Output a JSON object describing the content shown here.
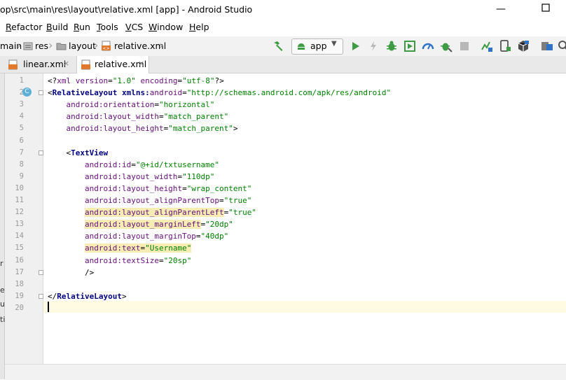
{
  "window": {
    "title": "op\\src\\main\\res\\layout\\relative.xml [app] - Android Studio",
    "minimize": "—",
    "maximize": "☐"
  },
  "menu": {
    "items": [
      {
        "label": "Refactor",
        "u": "R",
        "rest": "efactor"
      },
      {
        "label": "Build",
        "u": "B",
        "rest": "uild"
      },
      {
        "label": "Run",
        "u": "R",
        "rest": "un"
      },
      {
        "label": "Tools",
        "u": "T",
        "rest": "ools"
      },
      {
        "label": "VCS",
        "u": "V",
        "rest": "CS"
      },
      {
        "label": "Window",
        "u": "W",
        "rest": "indow"
      },
      {
        "label": "Help",
        "u": "H",
        "rest": "elp"
      }
    ]
  },
  "breadcrumbs": {
    "items": [
      "main",
      "res",
      "layout",
      "relative.xml"
    ]
  },
  "toolbar": {
    "run_config": "app",
    "accent": "#3d9b44"
  },
  "tabs": [
    {
      "label": "linear.xml",
      "close": "×",
      "active": false
    },
    {
      "label": "relative.xml",
      "close": "×",
      "active": true
    }
  ],
  "editor": {
    "line_numbers": [
      "1",
      "2",
      "3",
      "4",
      "5",
      "6",
      "7",
      "8",
      "9",
      "10",
      "11",
      "12",
      "13",
      "14",
      "15",
      "16",
      "17",
      "18",
      "19",
      "20"
    ],
    "gutter_marker": "C",
    "lines": [
      [
        {
          "t": "<?",
          "c": "plain"
        },
        {
          "t": "xml version",
          "c": "attr"
        },
        {
          "t": "=",
          "c": "plain"
        },
        {
          "t": "\"1.0\"",
          "c": "val"
        },
        {
          "t": " encoding",
          "c": "attr"
        },
        {
          "t": "=",
          "c": "plain"
        },
        {
          "t": "\"utf-8\"",
          "c": "val"
        },
        {
          "t": "?>",
          "c": "plain"
        }
      ],
      [
        {
          "t": "<",
          "c": "plain"
        },
        {
          "t": "RelativeLayout",
          "c": "tag"
        },
        {
          "t": " xmlns:",
          "c": "tag"
        },
        {
          "t": "android",
          "c": "attr"
        },
        {
          "t": "=",
          "c": "plain"
        },
        {
          "t": "\"http://schemas.android.com/apk/res/android\"",
          "c": "val"
        }
      ],
      [
        {
          "t": "    android:orientation",
          "c": "attr"
        },
        {
          "t": "=",
          "c": "plain"
        },
        {
          "t": "\"horizontal\"",
          "c": "val"
        }
      ],
      [
        {
          "t": "    android:layout_width",
          "c": "attr"
        },
        {
          "t": "=",
          "c": "plain"
        },
        {
          "t": "\"match_parent\"",
          "c": "val"
        }
      ],
      [
        {
          "t": "    android:layout_height",
          "c": "attr"
        },
        {
          "t": "=",
          "c": "plain"
        },
        {
          "t": "\"match_parent\"",
          "c": "val"
        },
        {
          "t": ">",
          "c": "plain"
        }
      ],
      [],
      [
        {
          "t": "    <",
          "c": "plain"
        },
        {
          "t": "TextView",
          "c": "tag"
        }
      ],
      [
        {
          "t": "        android:id",
          "c": "attr"
        },
        {
          "t": "=",
          "c": "plain"
        },
        {
          "t": "\"@+id/txtusername\"",
          "c": "val"
        }
      ],
      [
        {
          "t": "        android:layout_width",
          "c": "attr"
        },
        {
          "t": "=",
          "c": "plain"
        },
        {
          "t": "\"110dp\"",
          "c": "val"
        }
      ],
      [
        {
          "t": "        android:layout_height",
          "c": "attr"
        },
        {
          "t": "=",
          "c": "plain"
        },
        {
          "t": "\"wrap_content\"",
          "c": "val"
        }
      ],
      [
        {
          "t": "        android:layout_alignParentTop",
          "c": "attr"
        },
        {
          "t": "=",
          "c": "plain"
        },
        {
          "t": "\"true\"",
          "c": "val"
        }
      ],
      [
        {
          "t": "        ",
          "c": "plain"
        },
        {
          "t": "android:layout_alignParentLeft",
          "c": "attr",
          "hl": true
        },
        {
          "t": "=",
          "c": "plain"
        },
        {
          "t": "\"true\"",
          "c": "val"
        }
      ],
      [
        {
          "t": "        ",
          "c": "plain"
        },
        {
          "t": "android:layout_marginLeft",
          "c": "attr",
          "hl": true
        },
        {
          "t": "=",
          "c": "plain"
        },
        {
          "t": "\"20dp\"",
          "c": "val"
        }
      ],
      [
        {
          "t": "        android:layout_marginTop",
          "c": "attr"
        },
        {
          "t": "=",
          "c": "plain"
        },
        {
          "t": "\"40dp\"",
          "c": "val"
        }
      ],
      [
        {
          "t": "        ",
          "c": "plain"
        },
        {
          "t": "android:text",
          "c": "attr",
          "hl": true
        },
        {
          "t": "=",
          "c": "plain",
          "hl": true
        },
        {
          "t": "\"Username\"",
          "c": "val",
          "hl": true
        }
      ],
      [
        {
          "t": "        android:textSize",
          "c": "attr"
        },
        {
          "t": "=",
          "c": "plain"
        },
        {
          "t": "\"20sp\"",
          "c": "val"
        }
      ],
      [
        {
          "t": "        />",
          "c": "plain"
        }
      ],
      [],
      [
        {
          "t": "</",
          "c": "plain"
        },
        {
          "t": "RelativeLayout",
          "c": "tag"
        },
        {
          "t": ">",
          "c": "plain"
        }
      ],
      []
    ]
  },
  "side_chars": [
    "r",
    "e",
    "ul",
    "ti"
  ]
}
